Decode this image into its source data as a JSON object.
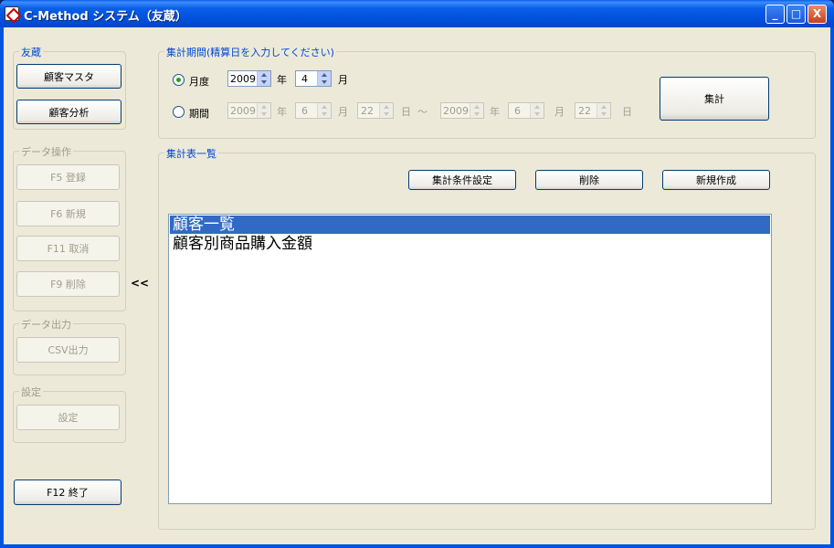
{
  "window": {
    "title": "C-Method システム（友蔵）",
    "controls": [
      "_",
      "□",
      "X"
    ]
  },
  "left_panel": {
    "group_main": {
      "label": "友蔵",
      "buttons": [
        "顧客マスタ",
        "顧客分析"
      ]
    },
    "group_data": {
      "label": "データ操作",
      "buttons": [
        "F5 登録",
        "F6 新規",
        "F11 取消",
        "F9 削除"
      ]
    },
    "group_output": {
      "label": "データ出力",
      "buttons": [
        "CSV出力"
      ]
    },
    "group_settings": {
      "label": "設定",
      "buttons": [
        "設定"
      ]
    },
    "exit_button": "F12 終了",
    "collapse_toggle": "<<"
  },
  "period": {
    "label": "集計期間(精算日を入力してください)",
    "monthly": {
      "label": "月度",
      "selected": true,
      "year": "2009",
      "year_unit": "年",
      "month": "4",
      "month_unit": "月"
    },
    "range": {
      "label": "期間",
      "selected": false,
      "from_year": "2009",
      "from_month": "6",
      "from_day": "22",
      "separator": "～",
      "to_year": "2009",
      "to_month": "6",
      "to_day": "22",
      "year_unit": "年",
      "month_unit": "月",
      "day_unit": "日"
    },
    "aggregate_button": "集計"
  },
  "table_list": {
    "label": "集計表一覧",
    "buttons": [
      "集計条件設定",
      "削除",
      "新規作成"
    ],
    "items": [
      {
        "label": "顧客一覧",
        "selected": true
      },
      {
        "label": "顧客別商品購入金額",
        "selected": false
      }
    ]
  },
  "colors": {
    "accent": "#0046d5",
    "selection": "#316ac5",
    "face": "#ece9d8"
  }
}
